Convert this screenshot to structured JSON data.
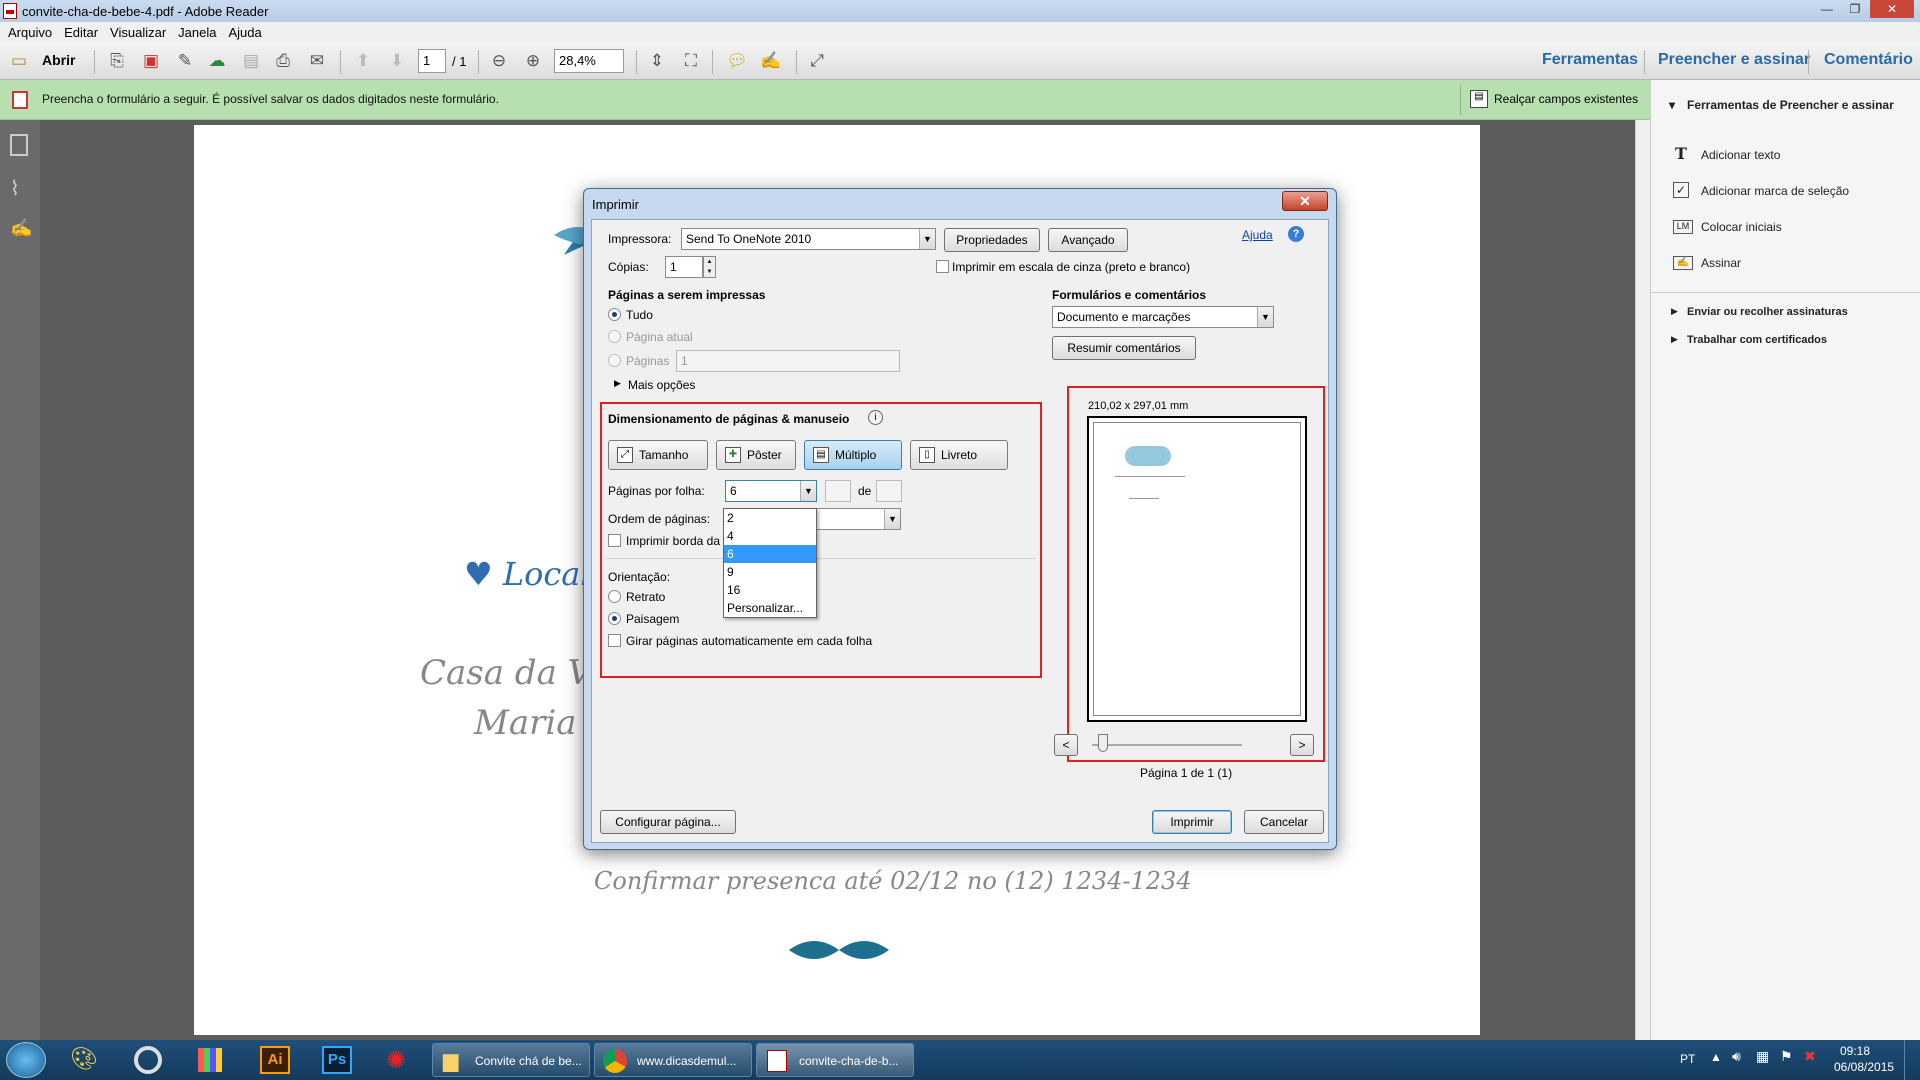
{
  "window": {
    "title": "convite-cha-de-bebe-4.pdf - Adobe Reader"
  },
  "menu": [
    "Arquivo",
    "Editar",
    "Visualizar",
    "Janela",
    "Ajuda"
  ],
  "toolbar": {
    "open_label": "Abrir",
    "page_current": "1",
    "page_total": "/ 1",
    "zoom": "28,4%",
    "right_tabs": [
      "Ferramentas",
      "Preencher e assinar",
      "Comentário"
    ]
  },
  "formbar": {
    "message": "Preencha o formulário a seguir. É possível salvar os dados digitados neste formulário.",
    "highlight_label": "Realçar campos existentes"
  },
  "document": {
    "local_heading": "♥ Local",
    "venue_line1": "Casa da Vo",
    "venue_line2": "Maria",
    "rsvp": "Confirmar presenca até 02/12 no (12) 1234-1234"
  },
  "rightpanel": {
    "section_title": "Ferramentas de Preencher e assinar",
    "items": [
      "Adicionar texto",
      "Adicionar marca de seleção",
      "Colocar iniciais",
      "Assinar"
    ],
    "collapsed": [
      "Enviar ou recolher assinaturas",
      "Trabalhar com certificados"
    ]
  },
  "dialog": {
    "title": "Imprimir",
    "printer_label": "Impressora:",
    "printer_value": "Send To OneNote 2010",
    "properties_btn": "Propriedades",
    "advanced_btn": "Avançado",
    "help_link": "Ajuda",
    "copies_label": "Cópias:",
    "copies_value": "1",
    "grayscale_label": "Imprimir em escala de cinza (preto e branco)",
    "pages_section": "Páginas a serem impressas",
    "opt_all": "Tudo",
    "opt_current": "Página atual",
    "opt_pages": "Páginas",
    "pages_value": "1",
    "more_options": "Mais opções",
    "sizing_section": "Dimensionamento de páginas & manuseio",
    "modes": [
      "Tamanho",
      "Pôster",
      "Múltiplo",
      "Livreto"
    ],
    "pages_per_sheet_label": "Páginas por folha:",
    "pages_per_sheet_value": "6",
    "of_label": "de",
    "page_order_label": "Ordem de páginas:",
    "print_border_label": "Imprimir borda da",
    "orientation_label": "Orientação:",
    "portrait": "Retrato",
    "landscape": "Paisagem",
    "auto_rotate": "Girar páginas automaticamente em cada folha",
    "dropdown_options": [
      "2",
      "4",
      "6",
      "9",
      "16",
      "Personalizar..."
    ],
    "forms_section": "Formulários e comentários",
    "forms_value": "Documento e marcações",
    "summarize_btn": "Resumir comentários",
    "preview_size": "210,02 x 297,01 mm",
    "preview_page": "Página 1 de 1 (1)",
    "page_setup_btn": "Configurar página...",
    "print_btn": "Imprimir",
    "cancel_btn": "Cancelar"
  },
  "taskbar": {
    "apps": [
      "Convite chá de be...",
      "www.dicasdemul...",
      "convite-cha-de-b..."
    ],
    "lang": "PT",
    "time": "09:18",
    "date": "06/08/2015"
  }
}
